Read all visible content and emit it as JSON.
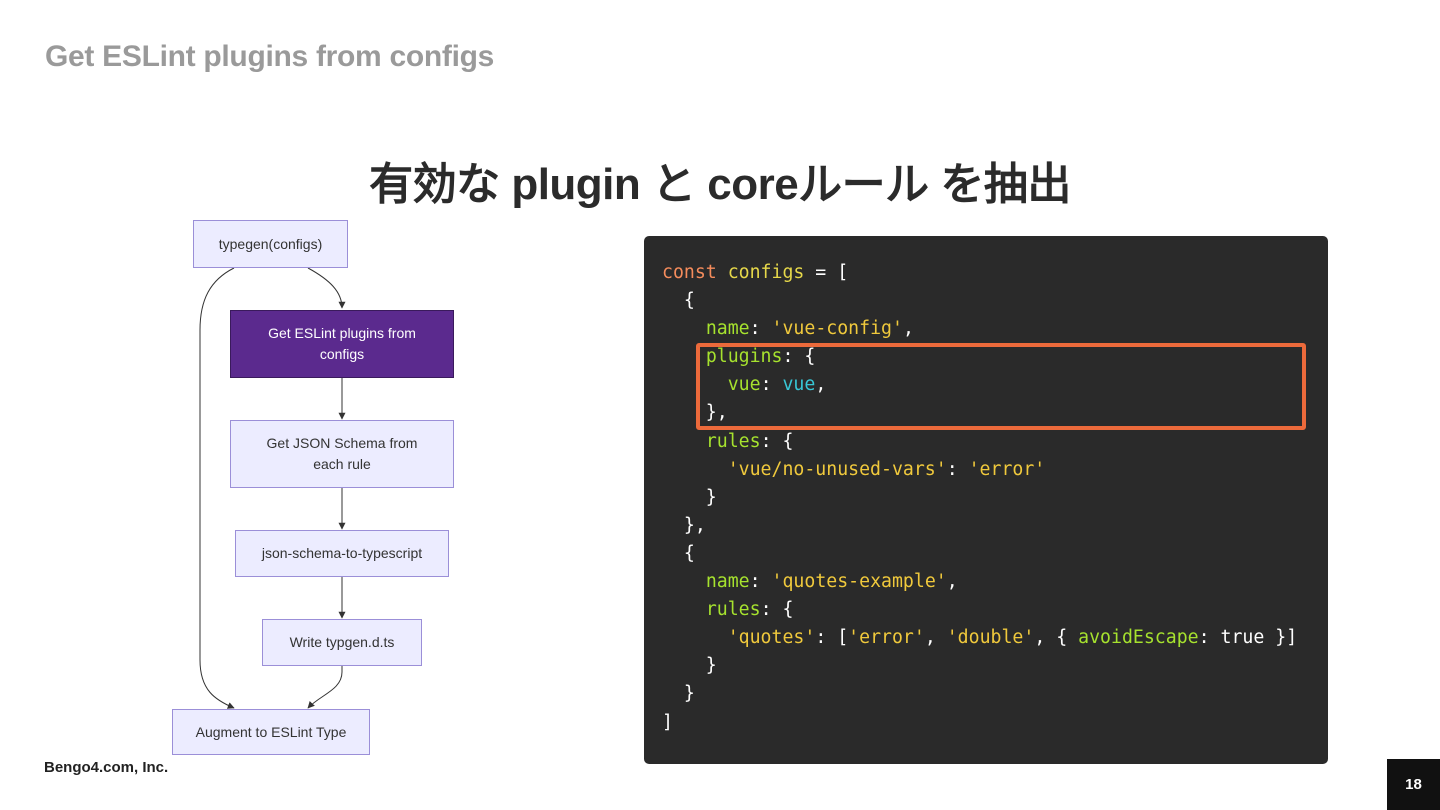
{
  "slide": {
    "section_title": "Get ESLint plugins from configs",
    "main_title": "有効な plugin と coreルール を抽出",
    "company": "Bengo4.com, Inc.",
    "page_number": "18"
  },
  "flowchart": {
    "nodes": [
      {
        "id": "typegen",
        "label": "typegen(configs)"
      },
      {
        "id": "get-plugins",
        "label": "Get ESLint plugins from configs",
        "active": true
      },
      {
        "id": "get-schema",
        "label": "Get JSON Schema from each rule"
      },
      {
        "id": "json-schema",
        "label": "json-schema-to-typescript"
      },
      {
        "id": "write",
        "label": "Write typgen.d.ts"
      },
      {
        "id": "augment",
        "label": "Augment to ESLint Type"
      }
    ],
    "colors": {
      "node_fill": "#ECECFF",
      "node_border": "#9b8fd8",
      "active_fill": "#5b2a8e",
      "edge": "#333333"
    }
  },
  "code": {
    "colors": {
      "background": "#2a2a2a",
      "keyword": "#f58c5c",
      "identifier": "#e6d84a",
      "property": "#a6e22e",
      "string": "#f0c93c",
      "value": "#38c7d6",
      "highlight": "#ec6a3b"
    },
    "lines": [
      [
        [
          "kw",
          "const"
        ],
        [
          "punc",
          " "
        ],
        [
          "id",
          "configs"
        ],
        [
          "punc",
          " = ["
        ]
      ],
      [
        [
          "punc",
          "  {"
        ]
      ],
      [
        [
          "punc",
          "    "
        ],
        [
          "prop",
          "name"
        ],
        [
          "punc",
          ": "
        ],
        [
          "str",
          "'vue-config'"
        ],
        [
          "punc",
          ","
        ]
      ],
      [
        [
          "punc",
          "    "
        ],
        [
          "prop",
          "plugins"
        ],
        [
          "punc",
          ": {"
        ]
      ],
      [
        [
          "punc",
          "      "
        ],
        [
          "prop",
          "vue"
        ],
        [
          "punc",
          ": "
        ],
        [
          "cyan",
          "vue"
        ],
        [
          "punc",
          ","
        ]
      ],
      [
        [
          "punc",
          "    },"
        ]
      ],
      [
        [
          "punc",
          "    "
        ],
        [
          "prop",
          "rules"
        ],
        [
          "punc",
          ": {"
        ]
      ],
      [
        [
          "punc",
          "      "
        ],
        [
          "str",
          "'vue/no-unused-vars'"
        ],
        [
          "punc",
          ": "
        ],
        [
          "str",
          "'error'"
        ]
      ],
      [
        [
          "punc",
          "    }"
        ]
      ],
      [
        [
          "punc",
          "  },"
        ]
      ],
      [
        [
          "punc",
          "  {"
        ]
      ],
      [
        [
          "punc",
          "    "
        ],
        [
          "prop",
          "name"
        ],
        [
          "punc",
          ": "
        ],
        [
          "str",
          "'quotes-example'"
        ],
        [
          "punc",
          ","
        ]
      ],
      [
        [
          "punc",
          "    "
        ],
        [
          "prop",
          "rules"
        ],
        [
          "punc",
          ": {"
        ]
      ],
      [
        [
          "punc",
          "      "
        ],
        [
          "str",
          "'quotes'"
        ],
        [
          "punc",
          ": ["
        ],
        [
          "str",
          "'error'"
        ],
        [
          "punc",
          ", "
        ],
        [
          "str",
          "'double'"
        ],
        [
          "punc",
          ", { "
        ],
        [
          "prop",
          "avoidEscape"
        ],
        [
          "punc",
          ": true }]"
        ]
      ],
      [
        [
          "punc",
          "    }"
        ]
      ],
      [
        [
          "punc",
          "  }"
        ]
      ],
      [
        [
          "punc",
          "]"
        ]
      ]
    ]
  }
}
